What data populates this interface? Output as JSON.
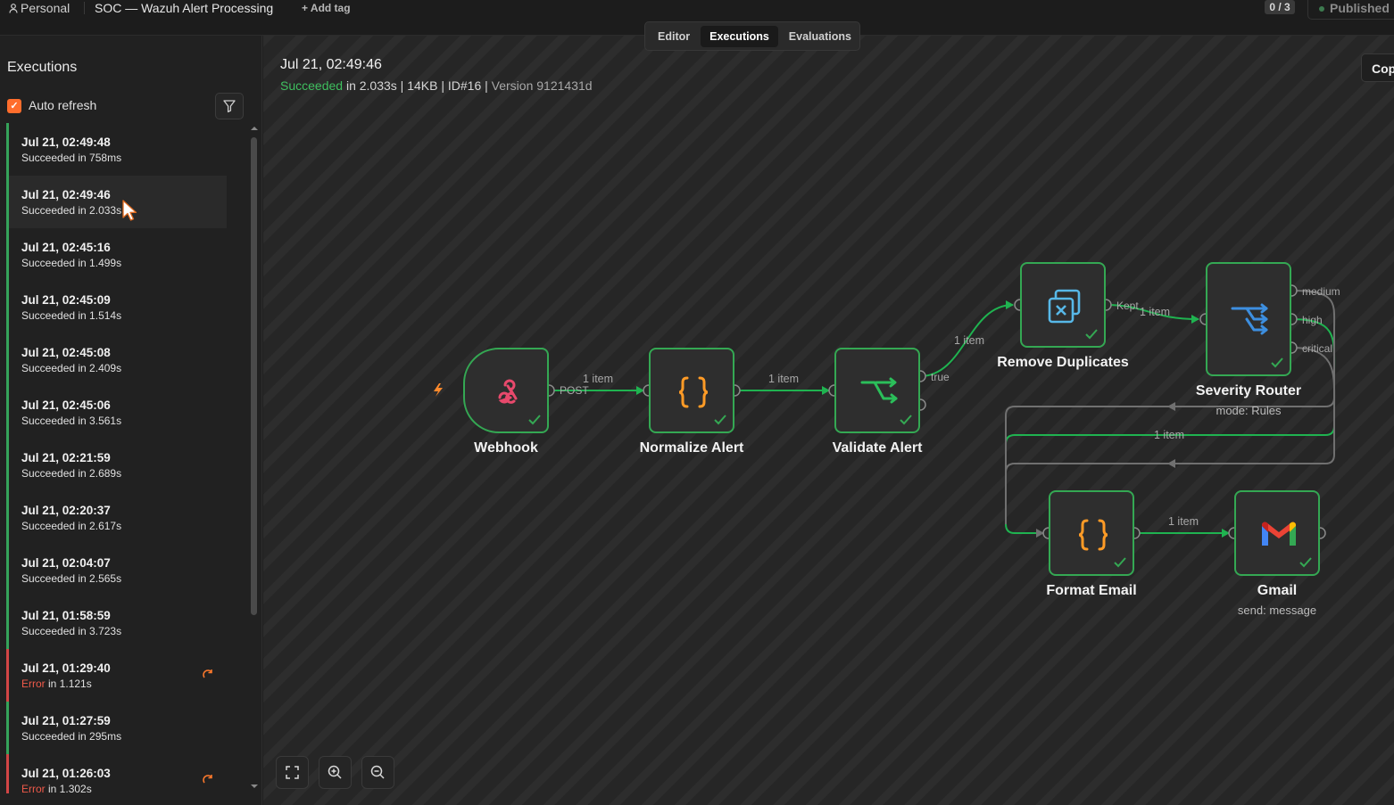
{
  "topbar": {
    "project": "Personal",
    "workflow_name": "SOC — Wazuh Alert Processing",
    "add_tag": "+ Add tag",
    "counter": "0 / 3",
    "published": "Published"
  },
  "tabs": [
    {
      "label": "Editor"
    },
    {
      "label": "Executions"
    },
    {
      "label": "Evaluations"
    }
  ],
  "sidebar": {
    "title": "Executions",
    "auto_refresh": "Auto refresh",
    "executions": [
      {
        "time": "Jul 21, 02:49:48",
        "status": "Succeeded",
        "duration": " in 758ms"
      },
      {
        "time": "Jul 21, 02:49:46",
        "status": "Succeeded",
        "duration": " in 2.033s"
      },
      {
        "time": "Jul 21, 02:45:16",
        "status": "Succeeded",
        "duration": " in 1.499s"
      },
      {
        "time": "Jul 21, 02:45:09",
        "status": "Succeeded",
        "duration": " in 1.514s"
      },
      {
        "time": "Jul 21, 02:45:08",
        "status": "Succeeded",
        "duration": " in 2.409s"
      },
      {
        "time": "Jul 21, 02:45:06",
        "status": "Succeeded",
        "duration": " in 3.561s"
      },
      {
        "time": "Jul 21, 02:21:59",
        "status": "Succeeded",
        "duration": " in 2.689s"
      },
      {
        "time": "Jul 21, 02:20:37",
        "status": "Succeeded",
        "duration": " in 2.617s"
      },
      {
        "time": "Jul 21, 02:04:07",
        "status": "Succeeded",
        "duration": " in 2.565s"
      },
      {
        "time": "Jul 21, 01:58:59",
        "status": "Succeeded",
        "duration": " in 3.723s"
      },
      {
        "time": "Jul 21, 01:29:40",
        "status": "Error",
        "duration": " in 1.121s"
      },
      {
        "time": "Jul 21, 01:27:59",
        "status": "Succeeded",
        "duration": " in 295ms"
      },
      {
        "time": "Jul 21, 01:26:03",
        "status": "Error",
        "duration": " in 1.302s"
      }
    ]
  },
  "execution": {
    "title": "Jul 21, 02:49:46",
    "status": "Succeeded",
    "duration": " in 2.033s",
    "size": "14KB",
    "id": "ID#16",
    "version": "Version 9121431d",
    "copy_button": "Copy"
  },
  "nodes": {
    "webhook": {
      "label": "Webhook",
      "icon": "webhook-icon",
      "output": "POST"
    },
    "normalize": {
      "label": "Normalize Alert",
      "icon": "code-braces-icon"
    },
    "validate": {
      "label": "Validate Alert",
      "icon": "if-branch-icon",
      "output": "true"
    },
    "dedupe": {
      "label": "Remove Duplicates",
      "icon": "remove-duplicates-icon",
      "output": "Kept"
    },
    "router": {
      "label": "Severity Router",
      "subtitle": "mode: Rules",
      "icon": "switch-icon",
      "outputs": [
        "medium",
        "high",
        "critical"
      ]
    },
    "format": {
      "label": "Format Email",
      "icon": "code-braces-icon"
    },
    "gmail": {
      "label": "Gmail",
      "subtitle": "send: message",
      "icon": "gmail-icon"
    }
  },
  "edge_labels": {
    "webhook_normalize": "1 item",
    "normalize_validate": "1 item",
    "validate_dedupe": "1 item",
    "dedupe_router": "1 item",
    "router_format": "1 item",
    "format_gmail": "1 item"
  },
  "colors": {
    "success": "#34a853",
    "error": "#ef5a4a",
    "accent": "#ff6d2c",
    "edge_active": "#1fb350",
    "edge_idle": "#7a7a7a"
  }
}
